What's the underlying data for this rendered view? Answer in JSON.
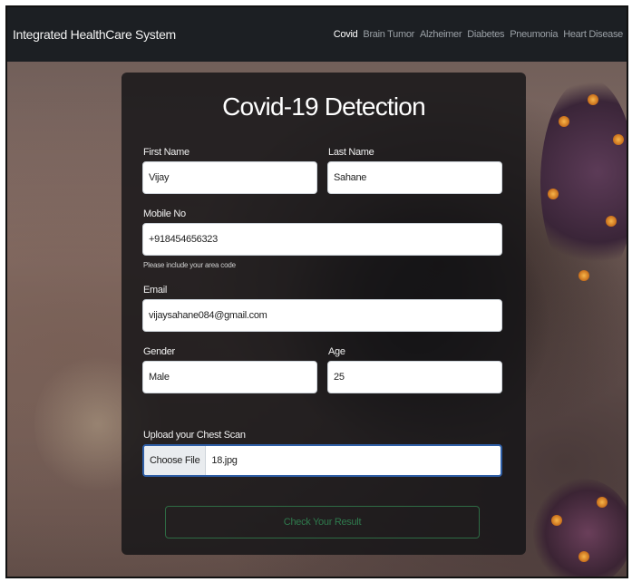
{
  "navbar": {
    "brand": "Integrated HealthCare System",
    "links": [
      {
        "label": "Covid"
      },
      {
        "label": "Brain Tumor"
      },
      {
        "label": "Alzheimer"
      },
      {
        "label": "Diabetes"
      },
      {
        "label": "Pneumonia"
      },
      {
        "label": "Heart Disease"
      }
    ]
  },
  "form": {
    "title": "Covid-19 Detection",
    "first_name": {
      "label": "First Name",
      "value": "Vijay"
    },
    "last_name": {
      "label": "Last Name",
      "value": "Sahane"
    },
    "mobile": {
      "label": "Mobile No",
      "value": "+918454656323",
      "hint": "Please include your area code"
    },
    "email": {
      "label": "Email",
      "value": "vijaysahane084@gmail.com"
    },
    "gender": {
      "label": "Gender",
      "value": "Male"
    },
    "age": {
      "label": "Age",
      "value": "25"
    },
    "upload": {
      "label": "Upload your Chest Scan",
      "button": "Choose File",
      "file_name": "18.jpg"
    },
    "submit": "Check Your Result"
  },
  "colors": {
    "navbar_bg": "#1c1f23",
    "card_bg": "rgba(20,20,22,0.82)",
    "submit_text": "#2f7a4d",
    "file_border": "#2f5fa7"
  }
}
